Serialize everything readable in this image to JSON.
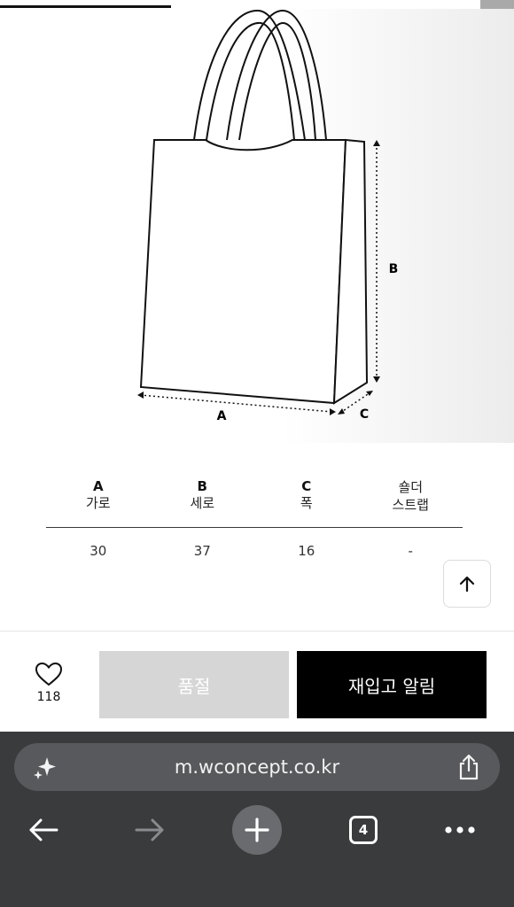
{
  "diagram": {
    "label_a": "A",
    "label_b": "B",
    "label_c": "C"
  },
  "size_table": {
    "columns": [
      {
        "letter": "A",
        "label": "가로",
        "label_2": "",
        "value": "30"
      },
      {
        "letter": "B",
        "label": "세로",
        "label_2": "",
        "value": "37"
      },
      {
        "letter": "C",
        "label": "폭",
        "label_2": "",
        "value": "16"
      },
      {
        "letter": "",
        "label": "숄더",
        "label_2": "스트랩",
        "value": "-"
      }
    ]
  },
  "action_bar": {
    "like_count": "118",
    "soldout_label": "품절",
    "restock_label": "재입고 알림"
  },
  "browser": {
    "url": "m.wconcept.co.kr",
    "tab_count": "4"
  },
  "colors": {
    "restock_bg": "#000000",
    "soldout_bg": "#d6d6d6",
    "browser_bg": "#3a3b3d"
  },
  "icons": [
    "heart-icon",
    "arrow-up-icon",
    "sparkle-icon",
    "share-icon",
    "back-arrow-icon",
    "forward-arrow-icon",
    "plus-icon",
    "more-icon"
  ]
}
